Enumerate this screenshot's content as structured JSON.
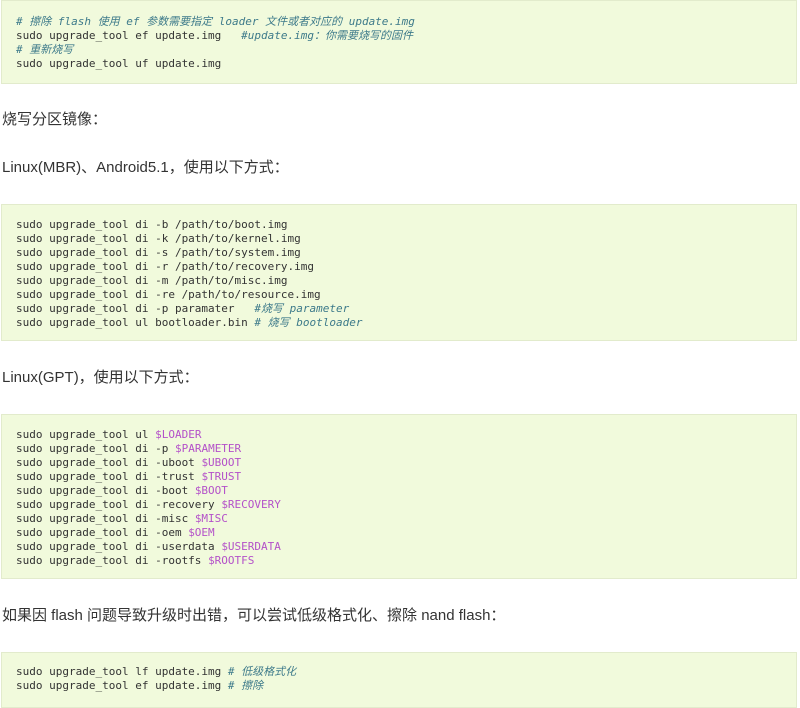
{
  "block1": {
    "lines": [
      {
        "parts": [
          {
            "t": "# 擦除 flash 使用 ef 参数需要指定 loader 文件或者对应的 update.img",
            "c": "cm"
          }
        ]
      },
      {
        "parts": [
          {
            "t": "sudo upgrade_tool ef update.img   ",
            "c": ""
          },
          {
            "t": "#update.img：你需要烧写的固件",
            "c": "cm"
          }
        ]
      },
      {
        "parts": [
          {
            "t": "# 重新烧写",
            "c": "cm"
          }
        ]
      },
      {
        "parts": [
          {
            "t": "sudo upgrade_tool uf update.img",
            "c": ""
          }
        ]
      }
    ]
  },
  "para1": "烧写分区镜像：",
  "para2": "Linux(MBR)、Android5.1，使用以下方式：",
  "block2": {
    "lines": [
      {
        "parts": [
          {
            "t": "sudo upgrade_tool di -b /path/to/boot.img",
            "c": ""
          }
        ]
      },
      {
        "parts": [
          {
            "t": "sudo upgrade_tool di -k /path/to/kernel.img",
            "c": ""
          }
        ]
      },
      {
        "parts": [
          {
            "t": "sudo upgrade_tool di -s /path/to/system.img",
            "c": ""
          }
        ]
      },
      {
        "parts": [
          {
            "t": "sudo upgrade_tool di -r /path/to/recovery.img",
            "c": ""
          }
        ]
      },
      {
        "parts": [
          {
            "t": "sudo upgrade_tool di -m /path/to/misc.img",
            "c": ""
          }
        ]
      },
      {
        "parts": [
          {
            "t": "sudo upgrade_tool di -re /path/to/resource.img",
            "c": ""
          }
        ]
      },
      {
        "parts": [
          {
            "t": "sudo upgrade_tool di -p paramater   ",
            "c": ""
          },
          {
            "t": "#烧写 parameter",
            "c": "cm"
          }
        ]
      },
      {
        "parts": [
          {
            "t": "sudo upgrade_tool ul bootloader.bin ",
            "c": ""
          },
          {
            "t": "# 烧写 bootloader",
            "c": "cm"
          }
        ]
      }
    ]
  },
  "para3": "Linux(GPT)，使用以下方式：",
  "block3": {
    "lines": [
      {
        "parts": [
          {
            "t": "sudo upgrade_tool ul ",
            "c": ""
          },
          {
            "t": "$LOADER",
            "c": "var"
          }
        ]
      },
      {
        "parts": [
          {
            "t": "sudo upgrade_tool di -p ",
            "c": ""
          },
          {
            "t": "$PARAMETER",
            "c": "var"
          }
        ]
      },
      {
        "parts": [
          {
            "t": "sudo upgrade_tool di -uboot ",
            "c": ""
          },
          {
            "t": "$UBOOT",
            "c": "var"
          }
        ]
      },
      {
        "parts": [
          {
            "t": "sudo upgrade_tool di -trust ",
            "c": ""
          },
          {
            "t": "$TRUST",
            "c": "var"
          }
        ]
      },
      {
        "parts": [
          {
            "t": "sudo upgrade_tool di -boot ",
            "c": ""
          },
          {
            "t": "$BOOT",
            "c": "var"
          }
        ]
      },
      {
        "parts": [
          {
            "t": "sudo upgrade_tool di -recovery ",
            "c": ""
          },
          {
            "t": "$RECOVERY",
            "c": "var"
          }
        ]
      },
      {
        "parts": [
          {
            "t": "sudo upgrade_tool di -misc ",
            "c": ""
          },
          {
            "t": "$MISC",
            "c": "var"
          }
        ]
      },
      {
        "parts": [
          {
            "t": "sudo upgrade_tool di -oem ",
            "c": ""
          },
          {
            "t": "$OEM",
            "c": "var"
          }
        ]
      },
      {
        "parts": [
          {
            "t": "sudo upgrade_tool di -userdata ",
            "c": ""
          },
          {
            "t": "$USERDATA",
            "c": "var"
          }
        ]
      },
      {
        "parts": [
          {
            "t": "sudo upgrade_tool di -rootfs ",
            "c": ""
          },
          {
            "t": "$ROOTFS",
            "c": "var"
          }
        ]
      }
    ]
  },
  "para4": "如果因 flash 问题导致升级时出错，可以尝试低级格式化、擦除 nand flash：",
  "block4": {
    "lines": [
      {
        "parts": [
          {
            "t": "sudo upgrade_tool lf update.img ",
            "c": ""
          },
          {
            "t": "# 低级格式化",
            "c": "cm"
          }
        ]
      },
      {
        "parts": [
          {
            "t": "sudo upgrade_tool ef update.img ",
            "c": ""
          },
          {
            "t": "# 擦除",
            "c": "cm"
          }
        ]
      }
    ]
  }
}
